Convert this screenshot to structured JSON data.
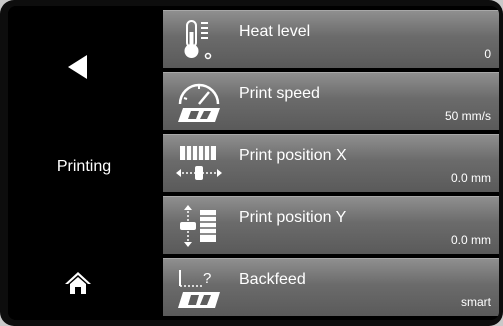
{
  "sidebar": {
    "title": "Printing",
    "back_icon": "back-arrow-icon",
    "home_icon": "home-icon"
  },
  "menu": {
    "items": [
      {
        "label": "Heat level",
        "value": "0",
        "icon": "thermometer-icon"
      },
      {
        "label": "Print speed",
        "value": "50 mm/s",
        "icon": "speedometer-icon"
      },
      {
        "label": "Print position X",
        "value": "0.0 mm",
        "icon": "horizontal-position-icon"
      },
      {
        "label": "Print position Y",
        "value": "0.0 mm",
        "icon": "vertical-position-icon"
      },
      {
        "label": "Backfeed",
        "value": "smart",
        "icon": "backfeed-icon"
      }
    ]
  }
}
